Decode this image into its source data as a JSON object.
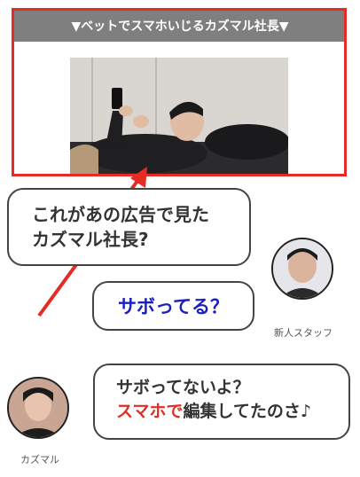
{
  "banner": {
    "text": "▼ベットでスマホいじるカズマル社長▼"
  },
  "photo": {
    "alt_subject": "person lying down holding smartphone"
  },
  "bubbles": {
    "first": {
      "line1": "これがあの広告で見た",
      "line2": "カズマル社長?"
    },
    "second": {
      "text": "サボってる？"
    },
    "third": {
      "line1": "サボってないよ？",
      "line2_highlight": "スマホで",
      "line2_rest": "編集してたのさ♪"
    }
  },
  "speakers": {
    "staff": {
      "name": "新人スタッフ"
    },
    "kazumaru": {
      "name": "カズマル"
    }
  },
  "colors": {
    "accent_red": "#e52b23",
    "question_blue": "#1a1fbf",
    "banner_gray": "#7f7f7f"
  }
}
